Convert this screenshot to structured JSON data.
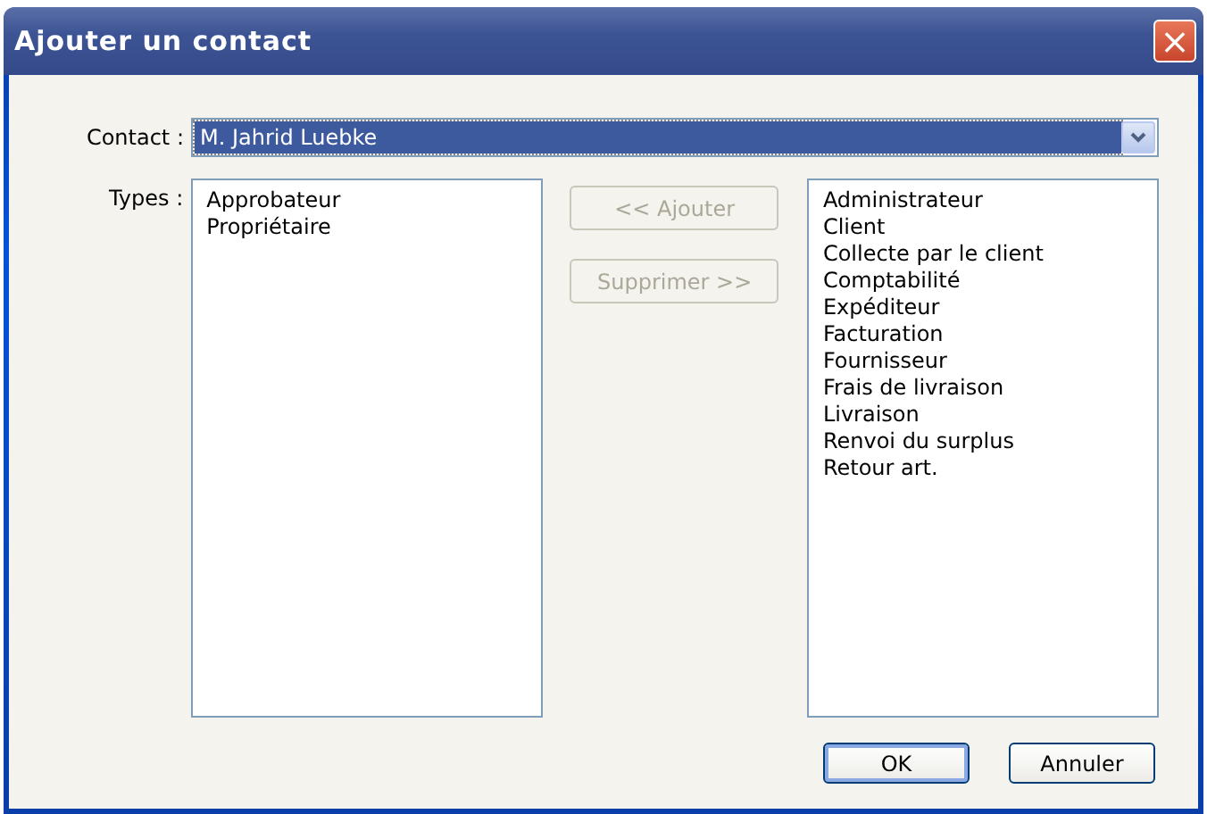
{
  "window": {
    "title": "Ajouter un contact",
    "close": "×"
  },
  "contact": {
    "label": "Contact :",
    "value": "M. Jahrid Luebke",
    "focused": true
  },
  "types_label": "Types :",
  "assigned": [
    "Approbateur",
    "Propriétaire"
  ],
  "transfer_buttons": [
    {
      "label": "<< Ajouter",
      "disabled": true
    },
    {
      "label": "Supprimer >>",
      "disabled": true
    }
  ],
  "available": [
    "Administrateur",
    "Client",
    "Collecte par le client",
    "Comptabilité",
    "Expéditeur",
    "Facturation",
    "Fournisseur",
    "Frais de livraison",
    "Livraison",
    "Renvoi du surplus",
    "Retour art."
  ],
  "buttons": [
    {
      "label": "OK",
      "default": true
    },
    {
      "label": "Annuler",
      "default": false
    }
  ]
}
